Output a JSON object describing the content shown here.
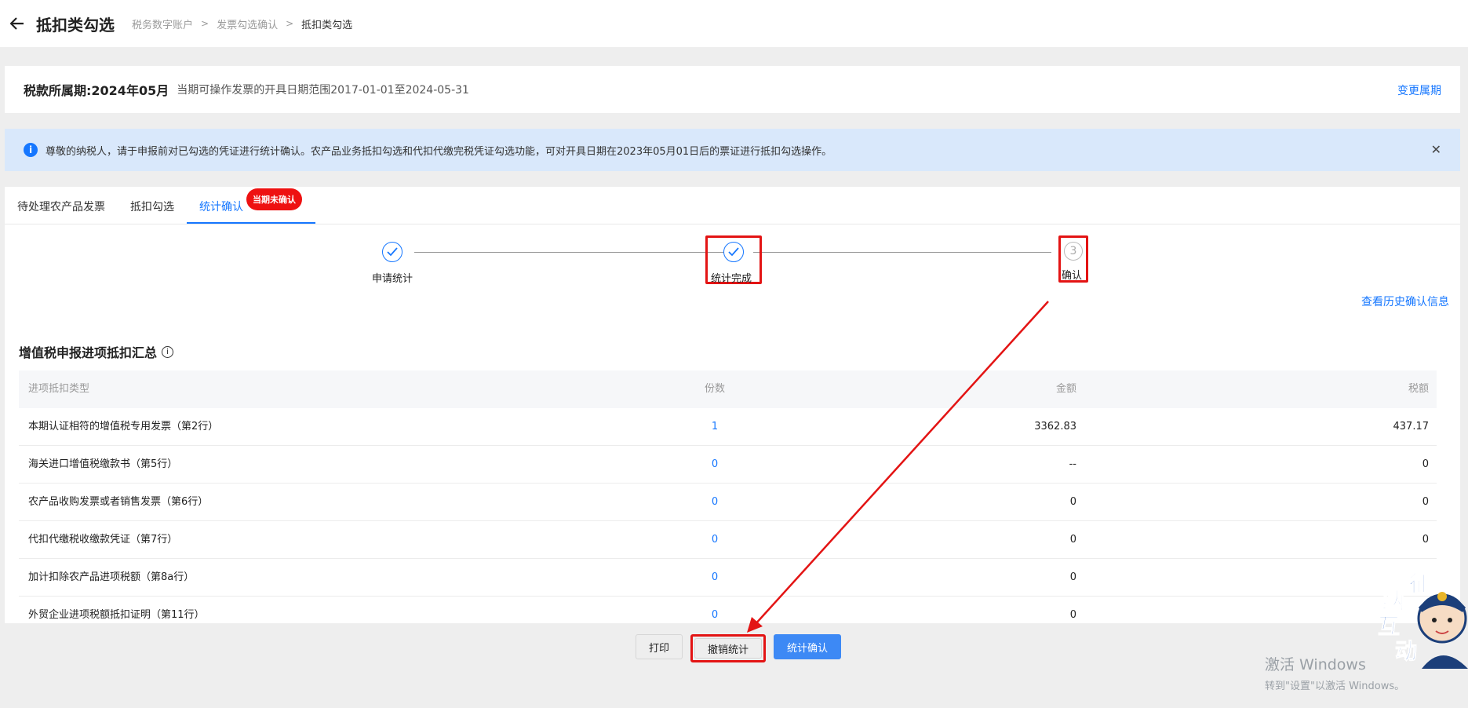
{
  "header": {
    "title": "抵扣类勾选",
    "breadcrumbs": [
      "税务数字账户",
      "发票勾选确认",
      "抵扣类勾选"
    ]
  },
  "period": {
    "label": "税款所属期:",
    "value": "2024年05月",
    "range": "当期可操作发票的开具日期范围2017-01-01至2024-05-31",
    "change_label": "变更属期"
  },
  "notice": {
    "text": "尊敬的纳税人，请于申报前对已勾选的凭证进行统计确认。农产品业务抵扣勾选和代扣代缴完税凭证勾选功能，可对开具日期在2023年05月01日后的票证进行抵扣勾选操作。"
  },
  "tabs": [
    {
      "label": "待处理农产品发票"
    },
    {
      "label": "抵扣勾选"
    },
    {
      "label": "统计确认",
      "badge": "当期未确认"
    }
  ],
  "steps": [
    {
      "label": "申请统计",
      "status": "done"
    },
    {
      "label": "统计完成",
      "status": "done"
    },
    {
      "label": "确认",
      "number": "3",
      "status": "pending"
    }
  ],
  "history_link": "查看历史确认信息",
  "summary": {
    "title": "增值税申报进项抵扣汇总",
    "columns": [
      "进项抵扣类型",
      "份数",
      "金额",
      "税额"
    ],
    "rows": [
      {
        "type": "本期认证相符的增值税专用发票（第2行）",
        "count": "1",
        "amount": "3362.83",
        "tax": "437.17"
      },
      {
        "type": "海关进口增值税缴款书（第5行）",
        "count": "0",
        "amount": "--",
        "tax": "0"
      },
      {
        "type": "农产品收购发票或者销售发票（第6行）",
        "count": "0",
        "amount": "0",
        "tax": "0"
      },
      {
        "type": "代扣代缴税收缴款凭证（第7行）",
        "count": "0",
        "amount": "0",
        "tax": "0"
      },
      {
        "type": "加计扣除农产品进项税额（第8a行）",
        "count": "0",
        "amount": "0",
        "tax": ""
      },
      {
        "type": "外贸企业进项税额抵扣证明（第11行）",
        "count": "0",
        "amount": "0",
        "tax": ""
      }
    ]
  },
  "buttons": {
    "print": "打印",
    "cancel_stat": "撤销统计",
    "confirm_stat": "统计确认"
  },
  "mascot": {
    "chars": [
      "征",
      "纳",
      "互",
      "动"
    ]
  },
  "watermark": {
    "line1": "激活 Windows",
    "line2": "转到\"设置\"以激活 Windows。"
  },
  "colors": {
    "accent": "#1677ff",
    "highlight": "#e31414",
    "badge": "#ee1111"
  }
}
